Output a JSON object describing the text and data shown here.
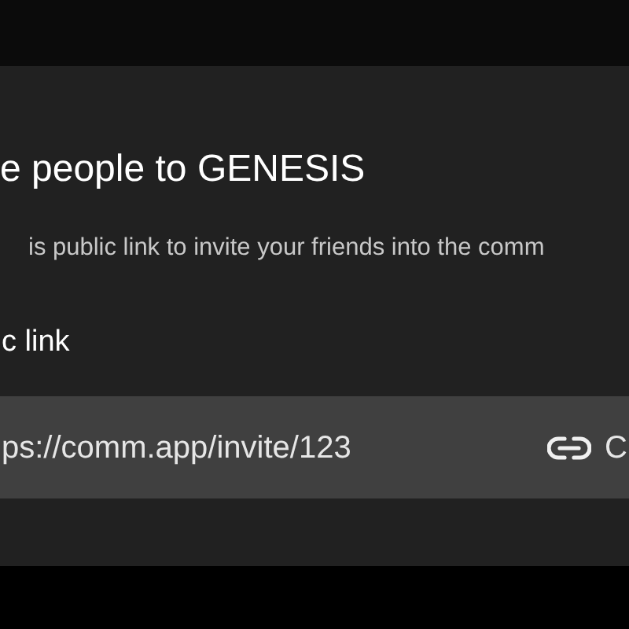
{
  "dialog": {
    "title": "e people to GENESIS",
    "description": "is public link to invite your friends into the comm",
    "section_label": "c link",
    "link": {
      "url": "ps://comm.app/invite/123",
      "action_text": "C"
    }
  }
}
